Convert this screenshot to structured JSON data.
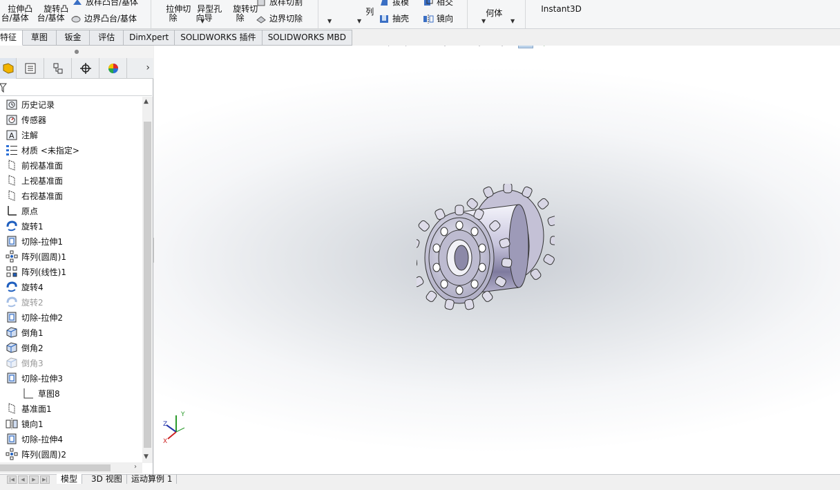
{
  "ribbon": {
    "extrude_boss": "拉伸凸\n台/基体",
    "revolve_boss": "旋转凸\n台/基体",
    "loft_boss": "放样凸台/基体",
    "boundary_boss": "边界凸台/基体",
    "extrude_cut": "拉伸切\n除",
    "hole_wizard": "异型孔\n向导",
    "revolve_cut": "旋转切\n除",
    "loft_cut": "放样切割",
    "boundary_cut": "边界切除",
    "pattern": "列",
    "draft": "拔模",
    "intersect": "相交",
    "shell": "抽壳",
    "mirror": "镜向",
    "reference_geometry": "何体",
    "instant3d": "Instant3D"
  },
  "tabs": [
    "特征",
    "草图",
    "钣金",
    "评估",
    "DimXpert",
    "SOLIDWORKS 插件",
    "SOLIDWORKS MBD"
  ],
  "feature_tree": [
    {
      "label": "历史记录",
      "icon": "history-icon",
      "dim": false
    },
    {
      "label": "传感器",
      "icon": "sensor-icon",
      "dim": false
    },
    {
      "label": "注解",
      "icon": "annotation-icon",
      "dim": false
    },
    {
      "label": "材质 <未指定>",
      "icon": "material-icon",
      "dim": false
    },
    {
      "label": "前视基准面",
      "icon": "plane-icon",
      "dim": false
    },
    {
      "label": "上视基准面",
      "icon": "plane-icon",
      "dim": false
    },
    {
      "label": "右视基准面",
      "icon": "plane-icon",
      "dim": false
    },
    {
      "label": "原点",
      "icon": "origin-icon",
      "dim": false
    },
    {
      "label": "旋转1",
      "icon": "revolve-icon",
      "dim": false
    },
    {
      "label": "切除-拉伸1",
      "icon": "cut-extrude-icon",
      "dim": false
    },
    {
      "label": "阵列(圆周)1",
      "icon": "circular-pattern-icon",
      "dim": false
    },
    {
      "label": "阵列(线性)1",
      "icon": "linear-pattern-icon",
      "dim": false
    },
    {
      "label": "旋转4",
      "icon": "revolve-icon",
      "dim": false
    },
    {
      "label": "旋转2",
      "icon": "revolve-icon",
      "dim": true
    },
    {
      "label": "切除-拉伸2",
      "icon": "cut-extrude-icon",
      "dim": false
    },
    {
      "label": "倒角1",
      "icon": "chamfer-icon",
      "dim": false
    },
    {
      "label": "倒角2",
      "icon": "chamfer-icon",
      "dim": false
    },
    {
      "label": "倒角3",
      "icon": "chamfer-icon",
      "dim": true
    },
    {
      "label": "切除-拉伸3",
      "icon": "cut-extrude-icon",
      "dim": false
    },
    {
      "label": "草图8",
      "icon": "sketch-icon",
      "dim": false,
      "indent": true
    },
    {
      "label": "基准面1",
      "icon": "plane-icon",
      "dim": false
    },
    {
      "label": "镜向1",
      "icon": "mirror-icon",
      "dim": false
    },
    {
      "label": "切除-拉伸4",
      "icon": "cut-extrude-icon",
      "dim": false
    },
    {
      "label": "阵列(圆周)2",
      "icon": "circular-pattern-icon",
      "dim": false
    }
  ],
  "bottom_tabs": [
    "模型",
    "3D 视图",
    "运动算例 1"
  ],
  "triad": {
    "x": "X",
    "y": "Y",
    "z": "Z"
  },
  "colors": {
    "accent": "#1f5fbf",
    "part": "#b9bccb",
    "tab_active": "#ffffff"
  }
}
